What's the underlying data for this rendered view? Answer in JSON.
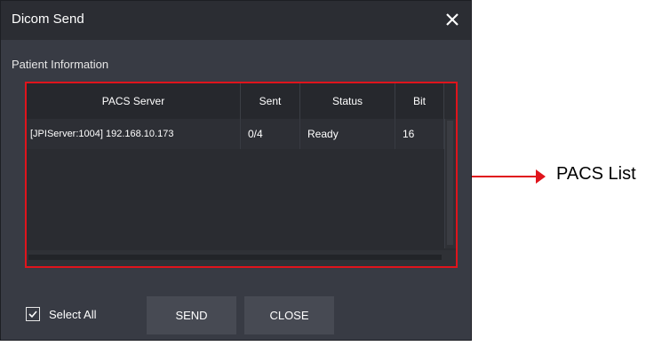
{
  "dialog": {
    "title": "Dicom Send",
    "close_icon": "close-icon",
    "section_label": "Patient Information"
  },
  "pacs_table": {
    "columns": [
      "PACS Server",
      "Sent",
      "Status",
      "Bit"
    ],
    "rows": [
      {
        "server": "[JPIServer:1004] 192.168.10.173",
        "sent": "0/4",
        "status": "Ready",
        "bit": "16"
      }
    ]
  },
  "footer": {
    "select_all_label": "Select All",
    "select_all_checked": true,
    "send_label": "SEND",
    "close_label": "CLOSE"
  },
  "annotation": {
    "label": "PACS List",
    "color": "#e0141c"
  }
}
